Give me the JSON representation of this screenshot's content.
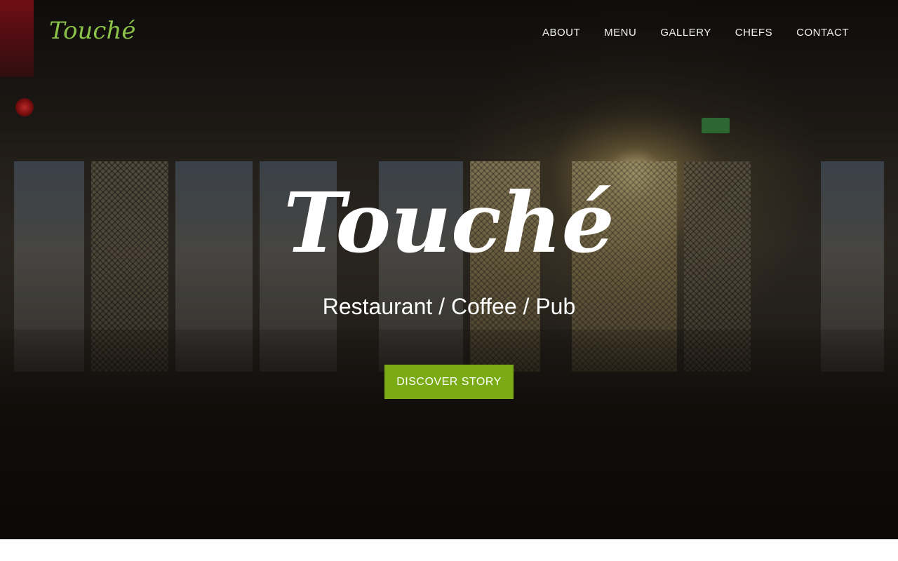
{
  "brand": {
    "logo_text": "Touché",
    "accent_color": "#8bc34a",
    "button_color": "#7aab15"
  },
  "nav": {
    "items": [
      {
        "label": "ABOUT"
      },
      {
        "label": "MENU"
      },
      {
        "label": "GALLERY"
      },
      {
        "label": "CHEFS"
      },
      {
        "label": "CONTACT"
      }
    ]
  },
  "hero": {
    "title": "Touché",
    "subtitle": "Restaurant / Coffee / Pub",
    "cta_label": "DISCOVER STORY",
    "background": "restaurant-interior-photo"
  }
}
